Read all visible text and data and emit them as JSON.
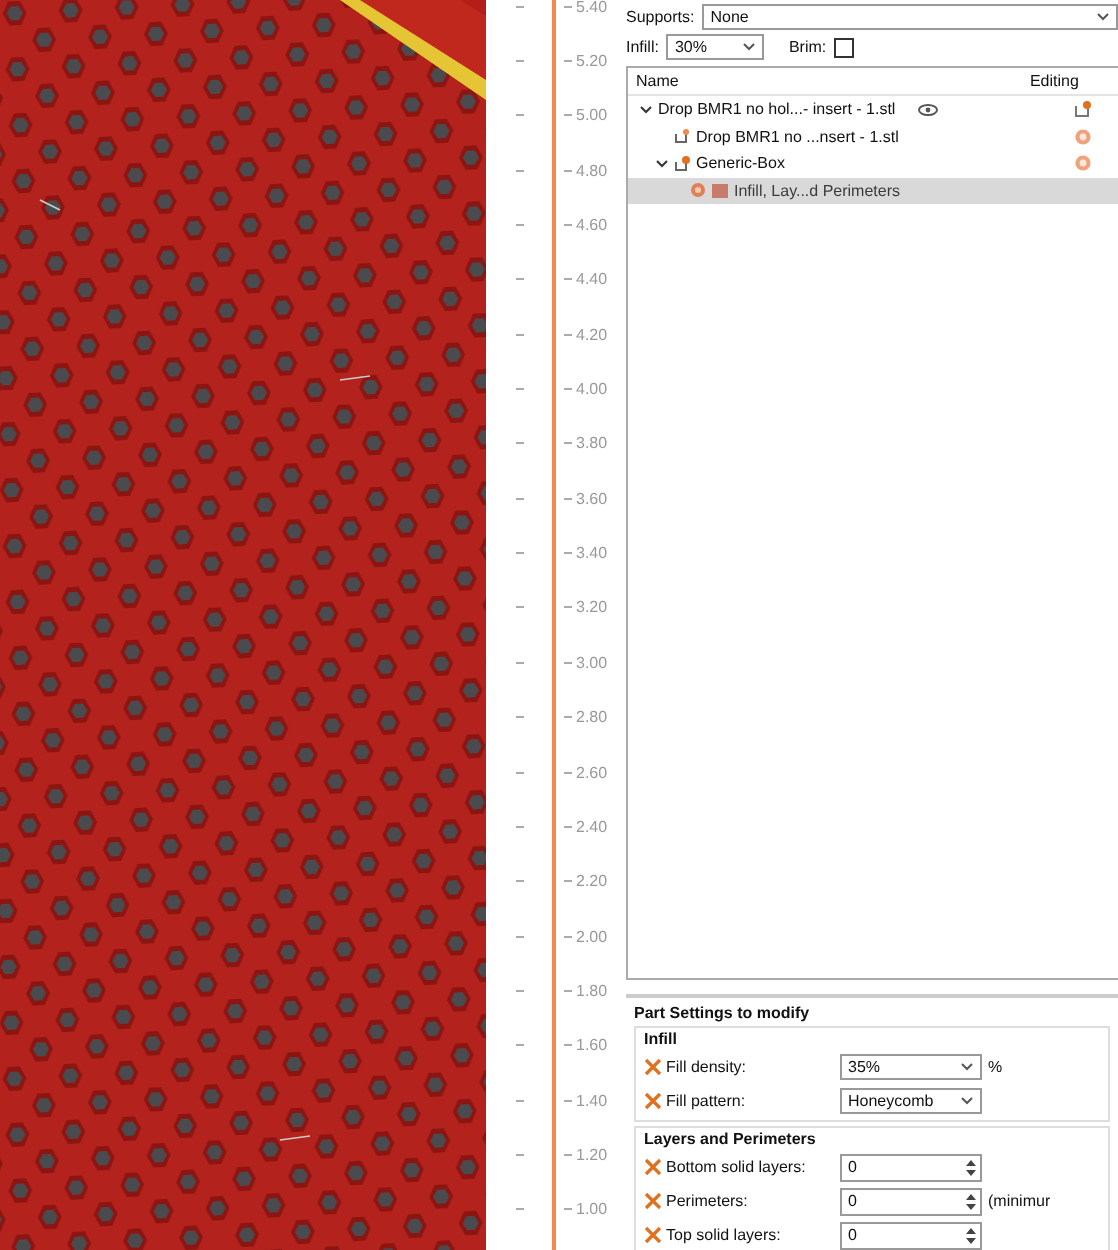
{
  "ruler": {
    "labels": [
      "5.40",
      "5.20",
      "5.00",
      "4.80",
      "4.60",
      "4.40",
      "4.20",
      "4.00",
      "3.80",
      "3.60",
      "3.40",
      "3.20",
      "3.00",
      "2.80",
      "2.60",
      "2.40",
      "2.20",
      "2.00",
      "1.80",
      "1.60",
      "1.40",
      "1.20",
      "1.00"
    ]
  },
  "print_settings": {
    "supports_label": "Supports:",
    "supports_value": "None",
    "infill_label": "Infill:",
    "infill_value": "30%",
    "brim_label": "Brim:",
    "brim_checked": false
  },
  "object_list": {
    "columns": [
      "Name",
      "Editing"
    ],
    "rows": [
      {
        "name": "Drop BMR1 no hol...- insert - 1.stl",
        "kind": "object",
        "expanded": true,
        "selected": false,
        "children": [
          {
            "name": "Drop BMR1 no ...nsert - 1.stl",
            "kind": "part",
            "selected": false
          },
          {
            "name": "Generic-Box",
            "kind": "modifier",
            "expanded": true,
            "selected": false,
            "children": [
              {
                "name": "Infill, Lay...d Perimeters",
                "kind": "settings",
                "selected": true
              }
            ]
          }
        ]
      }
    ]
  },
  "part_settings": {
    "title": "Part Settings to modify",
    "groups": [
      {
        "title": "Infill",
        "options": [
          {
            "kind": "select",
            "label": "Fill density:",
            "value": "35%",
            "suffix": "%"
          },
          {
            "kind": "select",
            "label": "Fill pattern:",
            "value": "Honeycomb"
          }
        ]
      },
      {
        "title": "Layers and Perimeters",
        "options": [
          {
            "kind": "spin",
            "label": "Bottom solid layers:",
            "value": "0"
          },
          {
            "kind": "spin",
            "label": "Perimeters:",
            "value": "0",
            "suffix": "(minimur"
          },
          {
            "kind": "spin",
            "label": "Top solid layers:",
            "value": "0"
          }
        ]
      }
    ]
  }
}
